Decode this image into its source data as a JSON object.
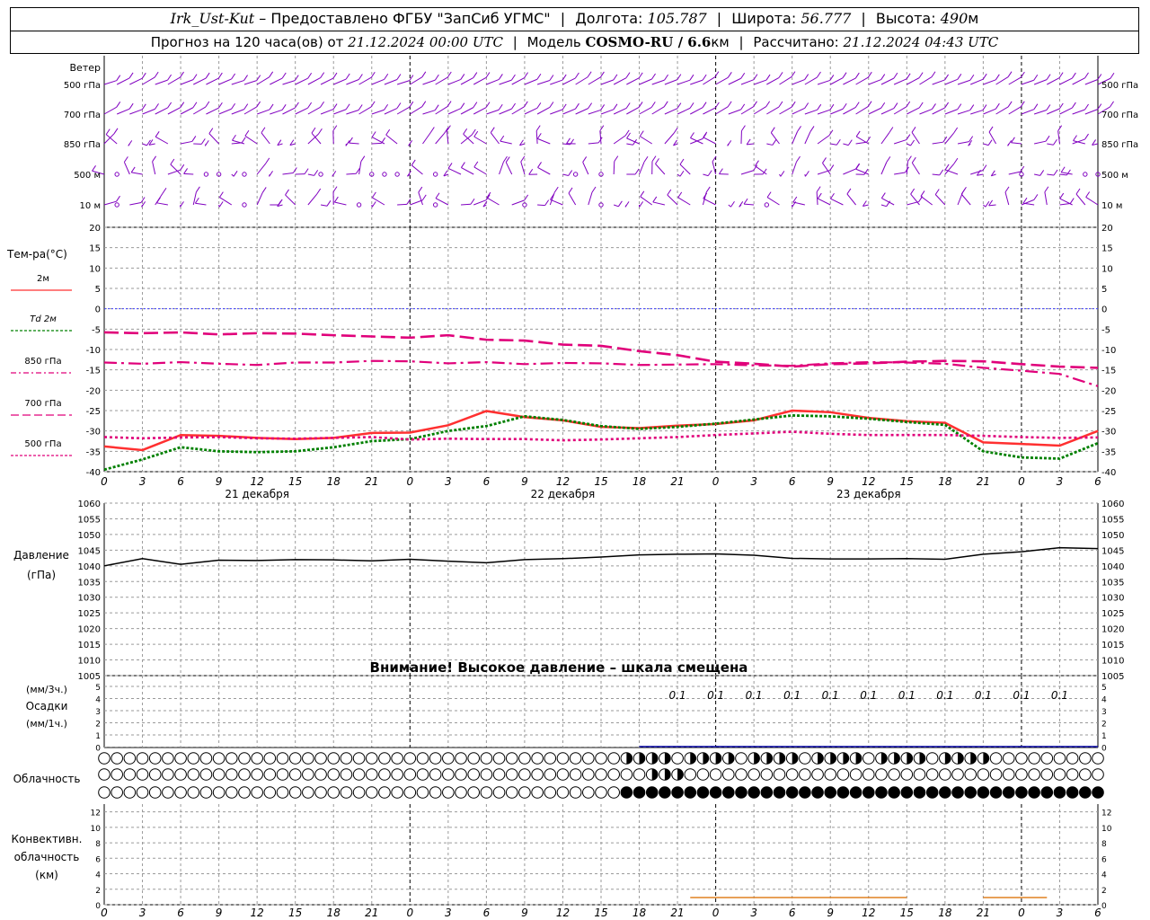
{
  "header": {
    "station": "Irk_Ust-Kut",
    "provided_by": "– Предоставлено ФГБУ \"ЗапСиб УГМС\"",
    "lon_label": "Долгота:",
    "lon_value": "105.787",
    "lat_label": "Широта:",
    "lat_value": "56.777",
    "alt_label": "Высота:",
    "alt_value": "490",
    "alt_unit": "м",
    "forecast_prefix": "Прогноз на 120 часа(ов) от",
    "forecast_time": "21.12.2024 00:00 UTC",
    "model_label": "Модель",
    "model_name": "COSMO-RU / 6.6",
    "model_unit": "км",
    "calc_label": "Рассчитано:",
    "calc_time": "21.12.2024 04:43 UTC"
  },
  "panels": {
    "wind": {
      "title": "Ветер",
      "levels": [
        "500 гПа",
        "700 гПа",
        "850 гПа",
        "500 м",
        "10 м"
      ],
      "color": "#8000c0"
    },
    "temp": {
      "title": "Тем-ра(°C)",
      "legend": [
        "2м",
        "Td 2м",
        "850 гПа",
        "700 гПа",
        "500 гПа"
      ],
      "ticks": [
        "20",
        "15",
        "10",
        "5",
        "0",
        "-5",
        "-10",
        "-15",
        "-20",
        "-25",
        "-30",
        "-35",
        "-40"
      ]
    },
    "pressure": {
      "title": "Давление",
      "unit": "(гПа)",
      "ticks": [
        "1060",
        "1055",
        "1050",
        "1045",
        "1040",
        "1035",
        "1030",
        "1025",
        "1020",
        "1015",
        "1010",
        "1005"
      ],
      "warning": "Внимание! Высокое давление – шкала смещена"
    },
    "precip": {
      "title": "Осадки",
      "unit3": "(мм/3ч.)",
      "unit1": "(мм/1ч.)",
      "ticks": [
        "5",
        "4",
        "3",
        "2",
        "1",
        "0"
      ],
      "labels": [
        "0.1",
        "0.1",
        "0.1",
        "0.1",
        "0.1",
        "0.1",
        "0.1",
        "0.1",
        "0.1",
        "0.1",
        "0.1"
      ]
    },
    "clouds": {
      "title": "Облачность"
    },
    "convective": {
      "title1": "Конвективн.",
      "title2": "облачность",
      "title3": "(км)",
      "ticks": [
        "12",
        "10",
        "8",
        "6",
        "4",
        "2",
        "0"
      ]
    }
  },
  "time_axis": {
    "hour_labels": [
      "0",
      "3",
      "6",
      "9",
      "12",
      "15",
      "18",
      "21",
      "0",
      "3",
      "6",
      "9",
      "12",
      "15",
      "18",
      "21",
      "0",
      "3",
      "6",
      "9",
      "12",
      "15",
      "18",
      "21",
      "0",
      "3",
      "6"
    ],
    "days": [
      "21 декабря",
      "22 декабря",
      "23 декабря"
    ]
  },
  "colors": {
    "t2m": "#ff3030",
    "td2m": "#008000",
    "t850": "#e0007a",
    "t700": "#e0007a",
    "t500": "#e0007a",
    "zero_line": "#4040ff",
    "pressure": "#000000",
    "precip": "#0000a0",
    "convective": "#e08020",
    "grid": "#9a9a9a"
  },
  "chart_data": [
    {
      "type": "line",
      "title": "Тем-ра(°C)",
      "x": [
        0,
        3,
        6,
        9,
        12,
        15,
        18,
        21,
        24,
        27,
        30,
        33,
        36,
        39,
        42,
        45,
        48,
        51,
        54,
        57,
        60,
        63,
        66,
        69,
        72,
        75,
        78
      ],
      "ylim": [
        -40,
        20
      ],
      "series": [
        {
          "name": "2м",
          "values": [
            -33.8,
            -34.7,
            -31.0,
            -31.2,
            -31.7,
            -32.0,
            -31.7,
            -30.5,
            -30.4,
            -28.6,
            -25.1,
            -26.6,
            -27.4,
            -29.0,
            -29.3,
            -28.7,
            -28.3,
            -27.4,
            -25.0,
            -25.4,
            -26.8,
            -27.6,
            -28.0,
            -32.8,
            -33.2,
            -33.6,
            -30.0
          ]
        },
        {
          "name": "Td 2м",
          "values": [
            -39.5,
            -37.0,
            -34.0,
            -35.0,
            -35.2,
            -35.0,
            -34.0,
            -32.5,
            -32.0,
            -30.0,
            -28.8,
            -26.4,
            -27.3,
            -28.8,
            -29.5,
            -29.0,
            -28.2,
            -27.2,
            -26.2,
            -26.4,
            -27.0,
            -27.8,
            -28.5,
            -35.0,
            -36.5,
            -36.8,
            -33.0
          ]
        },
        {
          "name": "850 гПа",
          "values": [
            -13.2,
            -13.5,
            -13.1,
            -13.5,
            -13.8,
            -13.2,
            -13.2,
            -12.8,
            -12.9,
            -13.4,
            -13.1,
            -13.6,
            -13.3,
            -13.4,
            -13.8,
            -13.7,
            -13.6,
            -13.9,
            -14.0,
            -13.4,
            -13.1,
            -13.2,
            -13.5,
            -14.5,
            -15.2,
            -16.0,
            -19.0
          ]
        },
        {
          "name": "700 гПа",
          "values": [
            -5.8,
            -6.0,
            -5.8,
            -6.3,
            -6.0,
            -6.1,
            -6.5,
            -6.8,
            -7.1,
            -6.5,
            -7.6,
            -7.8,
            -8.8,
            -9.1,
            -10.4,
            -11.4,
            -13.0,
            -13.5,
            -14.2,
            -13.6,
            -13.4,
            -13.0,
            -12.8,
            -12.9,
            -13.6,
            -14.2,
            -14.5
          ]
        },
        {
          "name": "500 гПа",
          "values": [
            -31.5,
            -31.8,
            -31.6,
            -31.5,
            -31.8,
            -31.9,
            -31.7,
            -31.5,
            -32.1,
            -31.9,
            -32.0,
            -32.0,
            -32.3,
            -32.1,
            -31.8,
            -31.5,
            -31.0,
            -30.6,
            -30.2,
            -30.7,
            -31.0,
            -31.0,
            -31.0,
            -31.2,
            -31.5,
            -31.7,
            -31.6
          ]
        }
      ]
    },
    {
      "type": "line",
      "title": "Давление",
      "x": [
        0,
        3,
        6,
        9,
        12,
        15,
        18,
        21,
        24,
        27,
        30,
        33,
        36,
        39,
        42,
        45,
        48,
        51,
        54,
        57,
        60,
        63,
        66,
        69,
        72,
        75,
        78
      ],
      "ylim": [
        1005,
        1060
      ],
      "series": [
        {
          "name": "Давление",
          "values": [
            1040.0,
            1042.3,
            1040.5,
            1041.8,
            1041.7,
            1042.0,
            1041.9,
            1041.6,
            1042.1,
            1041.5,
            1041.0,
            1042.0,
            1042.3,
            1042.8,
            1043.5,
            1043.7,
            1043.8,
            1043.4,
            1042.4,
            1042.2,
            1042.2,
            1042.3,
            1042.1,
            1043.7,
            1044.5,
            1045.8,
            1045.5
          ]
        }
      ]
    }
  ]
}
